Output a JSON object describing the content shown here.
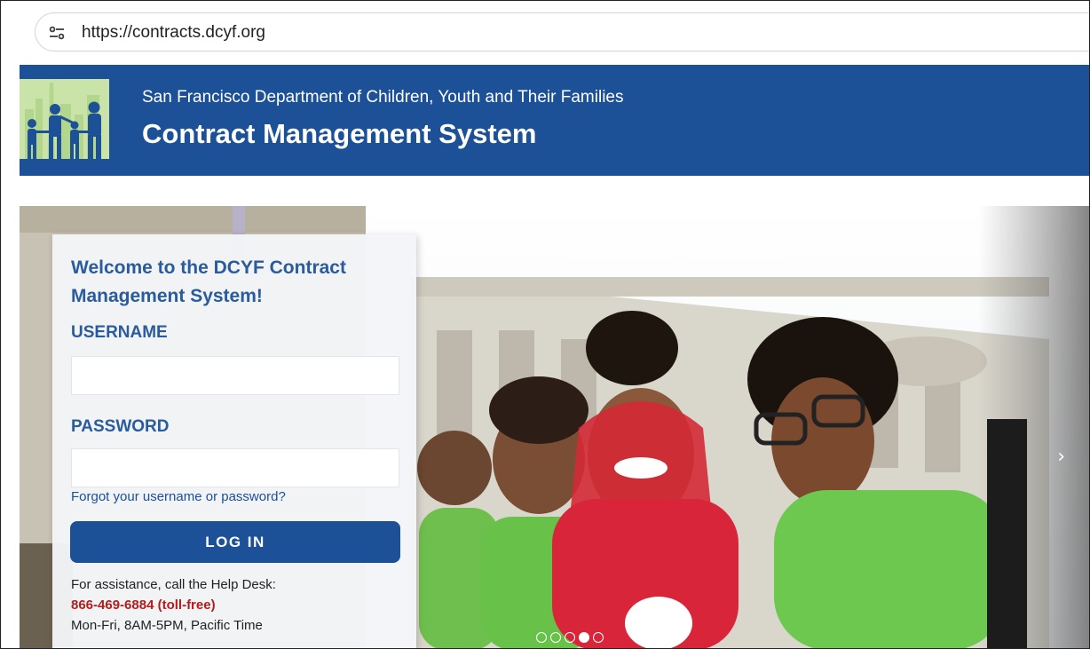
{
  "browser": {
    "url": "https://contracts.dcyf.org",
    "site_settings_icon": "tune-icon"
  },
  "header": {
    "org_name": "San Francisco Department of Children, Youth and Their Families",
    "system_name": "Contract Management System",
    "colors": {
      "band": "#1c5097"
    }
  },
  "login": {
    "welcome": "Welcome to the DCYF Contract Management System!",
    "username_label": "USERNAME",
    "password_label": "PASSWORD",
    "username_value": "",
    "password_value": "",
    "forgot_link": "Forgot your username or password?",
    "login_button": "LOG IN",
    "help_line1": "For assistance, call the Help Desk:",
    "help_phone": "866-469-6884 (toll-free)",
    "help_hours": "Mon-Fri, 8AM-5PM, Pacific Time"
  },
  "carousel": {
    "slide_count": 5,
    "active_index": 3,
    "next_icon": "chevron-right-icon",
    "next_glyph": "›"
  }
}
